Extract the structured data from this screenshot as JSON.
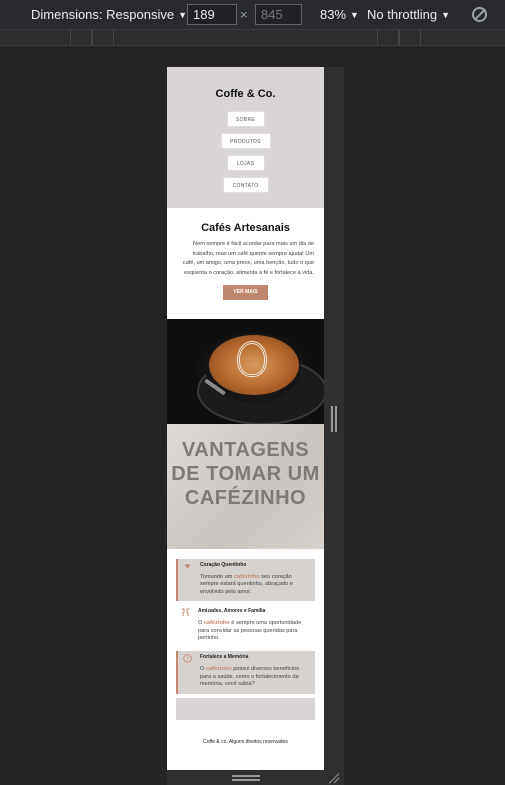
{
  "devtools": {
    "device_label": "Dimensions: Responsive",
    "width_value": "189",
    "height_placeholder": "845",
    "times_sign": "×",
    "zoom": "83%",
    "throttling": "No throttling",
    "icons": [
      "rotate-icon"
    ]
  },
  "site": {
    "logo": "Coffe & Co.",
    "nav": [
      "SOBRE",
      "PRODUTOS",
      "LOJAS",
      "CONTATO"
    ],
    "hero": {
      "title": "Cafés Artesanais",
      "text": "Nem sempre é fácil acordar para mais um dia de trabalho, mas um café quente sempre ajuda! Um café, um amigo, uma prece, uma benção, tudo o que esquenta o coração, alimenta a fé e fortalece a vida.",
      "cta": "VER MAIS"
    },
    "advantages_title": "VANTAGENS DE TOMAR UM CAFÉZINHO",
    "items": [
      {
        "title": "Coração Quentinho",
        "pre": "Tomando um ",
        "kw": "cafézinho",
        "post": " seu coração sempre estará quentinho, abraçado e envolvido pelo amor.",
        "icon": "heart-icon"
      },
      {
        "title": "Amizades, Amores e Família",
        "pre": "O ",
        "kw": "cafézinho",
        "post": " é sempre uma oportunidade para convidar as pessoas queridas para pertinho.",
        "icon": "cheers-icon"
      },
      {
        "title": "Fortalece a Memória",
        "pre": "O ",
        "kw": "cafézinho",
        "post": " possui diversos benefícios para a saúde, como o fortalecimento da memória, você sabia?",
        "icon": "question-icon"
      }
    ],
    "footer": "Coffe & co. Alguns direitos reservados"
  },
  "colors": {
    "accent": "#c0876e",
    "header_bg": "#d8d5d4",
    "devtools_bg": "#292a2d"
  }
}
